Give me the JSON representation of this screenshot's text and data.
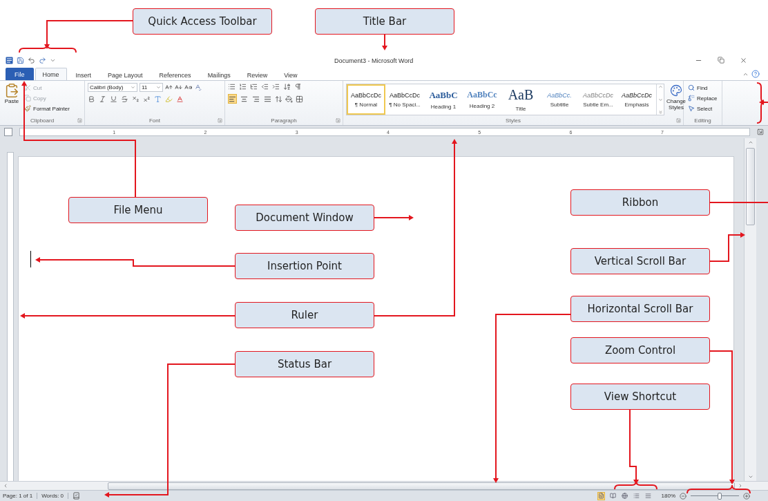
{
  "window": {
    "title": "Document3 - Microsoft Word"
  },
  "tabs": [
    {
      "label": "File",
      "kind": "backstage",
      "selected": false
    },
    {
      "label": "Home",
      "kind": "tab",
      "selected": true
    },
    {
      "label": "Insert",
      "kind": "tab",
      "selected": false
    },
    {
      "label": "Page Layout",
      "kind": "tab",
      "selected": false
    },
    {
      "label": "References",
      "kind": "tab",
      "selected": false
    },
    {
      "label": "Mailings",
      "kind": "tab",
      "selected": false
    },
    {
      "label": "Review",
      "kind": "tab",
      "selected": false
    },
    {
      "label": "View",
      "kind": "tab",
      "selected": false
    }
  ],
  "ribbon": {
    "clipboard": {
      "paste": "Paste",
      "label": "Clipboard",
      "items": [
        {
          "label": "Cut",
          "disabled": true
        },
        {
          "label": "Copy",
          "disabled": true
        },
        {
          "label": "Format Painter",
          "disabled": false
        }
      ]
    },
    "font": {
      "name": "Calibri (Body)",
      "size": "11",
      "label": "Font"
    },
    "paragraph": {
      "label": "Paragraph",
      "alignments": [
        {
          "selected": true
        },
        {
          "selected": false
        },
        {
          "selected": false
        },
        {
          "selected": false
        }
      ]
    },
    "styles": {
      "label": "Styles",
      "change": "Change Styles",
      "items": [
        {
          "preview": "AaBbCcDc",
          "label": "¶ Normal",
          "kind": "plain",
          "selected": true
        },
        {
          "preview": "AaBbCcDc",
          "label": "¶ No Spaci...",
          "kind": "plain",
          "selected": false
        },
        {
          "preview": "AaBbC",
          "label": "Heading 1",
          "kind": "heading1",
          "selected": false
        },
        {
          "preview": "AaBbCc",
          "label": "Heading 2",
          "kind": "heading2",
          "selected": false
        },
        {
          "preview": "AaB",
          "label": "Title",
          "kind": "title",
          "selected": false
        },
        {
          "preview": "AaBbCc.",
          "label": "Subtitle",
          "kind": "subtitle",
          "selected": false
        },
        {
          "preview": "AaBbCcDc",
          "label": "Subtle Em...",
          "kind": "subtle",
          "selected": false
        },
        {
          "preview": "AaBbCcDc",
          "label": "Emphasis",
          "kind": "emphasis",
          "selected": false
        }
      ]
    },
    "editing": {
      "label": "Editing",
      "items": [
        "Find",
        "Replace",
        "Select"
      ]
    }
  },
  "ruler": {
    "marks": [
      "1",
      "2",
      "3",
      "4",
      "5",
      "6",
      "7"
    ]
  },
  "status_bar": {
    "page": "Page: 1 of 1",
    "words": "Words: 0",
    "views": [
      {
        "selected": true
      },
      {
        "selected": false
      },
      {
        "selected": false
      },
      {
        "selected": false
      },
      {
        "selected": false
      }
    ],
    "zoom": {
      "reading": "180%",
      "level": 0.6
    }
  },
  "callouts": [
    {
      "label": "Quick Access Toolbar"
    },
    {
      "label": "Title Bar"
    },
    {
      "label": "File Menu"
    },
    {
      "label": "Document Window"
    },
    {
      "label": "Ribbon"
    },
    {
      "label": "Insertion Point"
    },
    {
      "label": "Vertical Scroll Bar"
    },
    {
      "label": "Ruler"
    },
    {
      "label": "Horizontal Scroll Bar"
    },
    {
      "label": "Status Bar"
    },
    {
      "label": "Zoom Control"
    },
    {
      "label": "View Shortcut"
    }
  ]
}
